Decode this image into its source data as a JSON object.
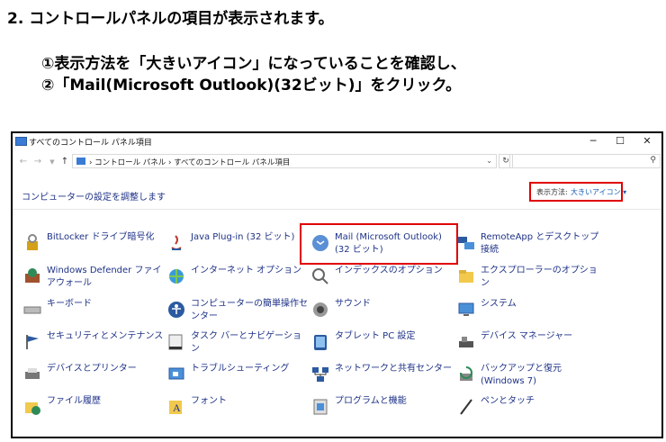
{
  "instructions": {
    "step_num": "2.",
    "step_text": "コントロールパネルの項目が表示されます。",
    "line1": "①表示方法を「大きいアイコン」になっていることを確認し、",
    "line2": "②「Mail(Microsoft  Outlook)(32ビット)」をクリック。"
  },
  "window": {
    "title": "すべてのコントロール パネル項目",
    "controls": {
      "minimize": "─",
      "maximize": "☐",
      "close": "✕"
    },
    "address": "› コントロール パネル  ›  すべてのコントロール パネル項目",
    "heading": "コンピューターの設定を調整します",
    "view_by_label": "表示方法:",
    "view_by_value": "大きいアイコン ▾"
  },
  "items": [
    {
      "label": "BitLocker ドライブ暗号化",
      "icon": "bitlocker-icon"
    },
    {
      "label": "Java Plug-in (32 ビット)",
      "icon": "java-icon"
    },
    {
      "label": "Mail (Microsoft Outlook) (32 ビット)",
      "icon": "mail-icon"
    },
    {
      "label": "RemoteApp とデスクトップ接続",
      "icon": "remoteapp-icon"
    },
    {
      "label": "Windows Defender ファイアウォール",
      "icon": "firewall-icon"
    },
    {
      "label": "インターネット オプション",
      "icon": "internet-options-icon"
    },
    {
      "label": "インデックスのオプション",
      "icon": "indexing-icon"
    },
    {
      "label": "エクスプローラーのオプション",
      "icon": "explorer-options-icon"
    },
    {
      "label": "キーボード",
      "icon": "keyboard-icon"
    },
    {
      "label": "コンピューターの簡単操作センター",
      "icon": "ease-of-access-icon"
    },
    {
      "label": "サウンド",
      "icon": "sound-icon"
    },
    {
      "label": "システム",
      "icon": "system-icon"
    },
    {
      "label": "セキュリティとメンテナンス",
      "icon": "security-flag-icon"
    },
    {
      "label": "タスク バーとナビゲーション",
      "icon": "taskbar-icon"
    },
    {
      "label": "タブレット PC 設定",
      "icon": "tablet-icon"
    },
    {
      "label": "デバイス マネージャー",
      "icon": "device-manager-icon"
    },
    {
      "label": "デバイスとプリンター",
      "icon": "printer-icon"
    },
    {
      "label": "トラブルシューティング",
      "icon": "troubleshoot-icon"
    },
    {
      "label": "ネットワークと共有センター",
      "icon": "network-icon"
    },
    {
      "label": "バックアップと復元 (Windows 7)",
      "icon": "backup-icon"
    },
    {
      "label": "ファイル履歴",
      "icon": "file-history-icon"
    },
    {
      "label": "フォント",
      "icon": "font-icon"
    },
    {
      "label": "プログラムと機能",
      "icon": "programs-icon"
    },
    {
      "label": "ペンとタッチ",
      "icon": "pen-icon"
    }
  ],
  "colors": {
    "link": "#1e3287",
    "highlight": "#e00000",
    "accent": "#1a5fb4"
  }
}
